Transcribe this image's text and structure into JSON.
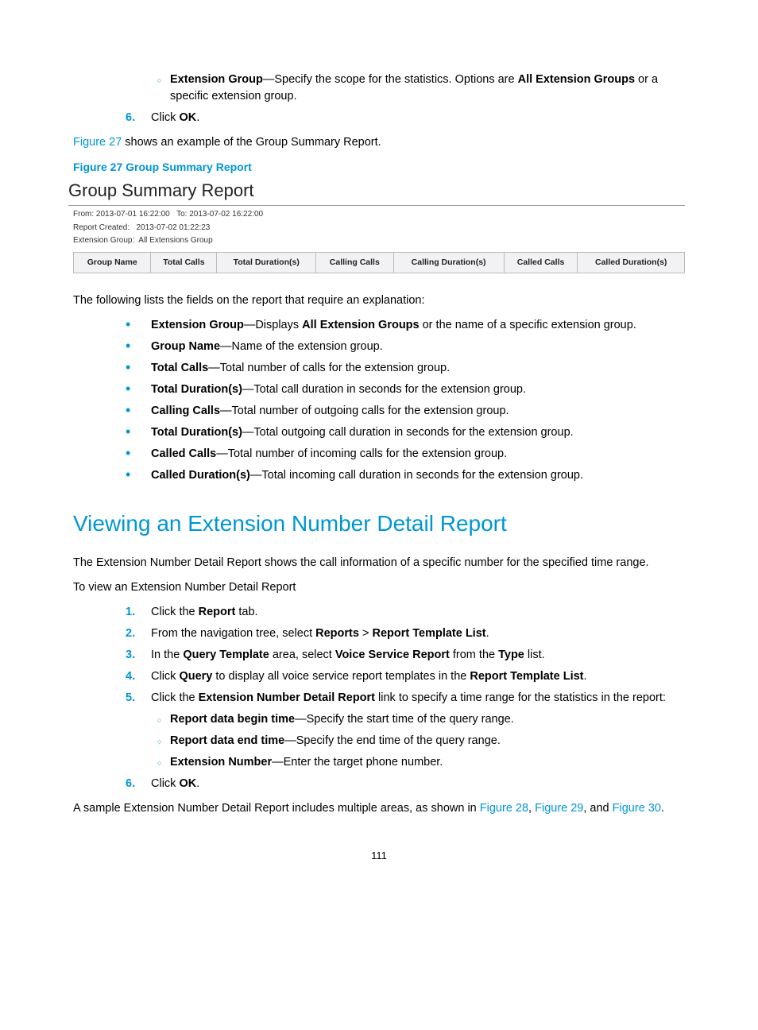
{
  "top_sub": {
    "label_bold": "Extension Group",
    "text1": "—Specify the scope for the statistics. Options are ",
    "options_bold": "All Extension Groups",
    "text2": " or a specific extension group."
  },
  "step6": {
    "num": "6.",
    "pre": "Click ",
    "ok": "OK",
    "post": "."
  },
  "fig_intro": {
    "link": "Figure 27",
    "rest": " shows an example of the Group Summary Report."
  },
  "fig27_caption": "Figure 27 Group Summary Report",
  "report": {
    "title": "Group Summary Report",
    "from_label": "From:",
    "from_val": "2013-07-01 16:22:00",
    "to_label": "To:",
    "to_val": "2013-07-02 16:22:00",
    "created_label": "Report Created:",
    "created_val": "2013-07-02 01:22:23",
    "extgrp_label": "Extension Group:",
    "extgrp_val": "All Extensions Group",
    "cols": [
      "Group Name",
      "Total Calls",
      "Total Duration(s)",
      "Calling Calls",
      "Calling Duration(s)",
      "Called Calls",
      "Called Duration(s)"
    ]
  },
  "explain_intro": "The following lists the fields on the report that require an explanation:",
  "defs": [
    {
      "term": "Extension Group",
      "dash": "—Displays ",
      "bold2": "All Extension Groups",
      "rest": " or the name of a specific extension group."
    },
    {
      "term": "Group Name",
      "dash": "—Name of the extension group."
    },
    {
      "term": "Total Calls",
      "dash": "—Total number of calls for the extension group."
    },
    {
      "term": "Total Duration(s)",
      "dash": "—Total call duration in seconds for the extension group."
    },
    {
      "term": "Calling Calls",
      "dash": "—Total number of outgoing calls for the extension group."
    },
    {
      "term": "Total Duration(s)",
      "dash": "—Total outgoing call duration in seconds for the extension group."
    },
    {
      "term": "Called Calls",
      "dash": "—Total number of incoming calls for the extension group."
    },
    {
      "term": "Called Duration(s)",
      "dash": "—Total incoming call duration in seconds for the extension group."
    }
  ],
  "h2": "Viewing an Extension Number Detail Report",
  "h2_desc": "The Extension Number Detail Report shows the call information of a specific number for the specified time range.",
  "to_view": "To view an Extension Number Detail Report",
  "steps": {
    "s1": {
      "num": "1.",
      "pre": "Click the ",
      "b1": "Report",
      "post": " tab."
    },
    "s2": {
      "num": "2.",
      "pre": "From the navigation tree, select ",
      "b1": "Reports",
      "gt": " > ",
      "b2": "Report Template List",
      "post": "."
    },
    "s3": {
      "num": "3.",
      "pre": "In the ",
      "b1": "Query Template",
      "mid": " area, select ",
      "b2": "Voice Service Report",
      "mid2": " from the ",
      "b3": "Type",
      "post": " list."
    },
    "s4": {
      "num": "4.",
      "pre": "Click ",
      "b1": "Query",
      "mid": " to display all voice service report templates in the ",
      "b2": "Report Template List",
      "post": "."
    },
    "s5": {
      "num": "5.",
      "pre": "Click the ",
      "b1": "Extension Number Detail Report",
      "post": " link to specify a time range for the statistics in the report:"
    },
    "s5_subs": [
      {
        "b": "Report data begin time",
        "rest": "—Specify the start time of the query range."
      },
      {
        "b": "Report data end time",
        "rest": "—Specify the end time of the query range."
      },
      {
        "b": "Extension Number",
        "rest": "—Enter the target phone number."
      }
    ],
    "s6": {
      "num": "6.",
      "pre": "Click ",
      "b1": "OK",
      "post": "."
    }
  },
  "tail": {
    "pre": "A sample Extension Number Detail Report includes multiple areas, as shown in ",
    "l1": "Figure 28",
    "c1": ", ",
    "l2": "Figure 29",
    "c2": ", and ",
    "l3": "Figure 30",
    "post": "."
  },
  "page_num": "111"
}
